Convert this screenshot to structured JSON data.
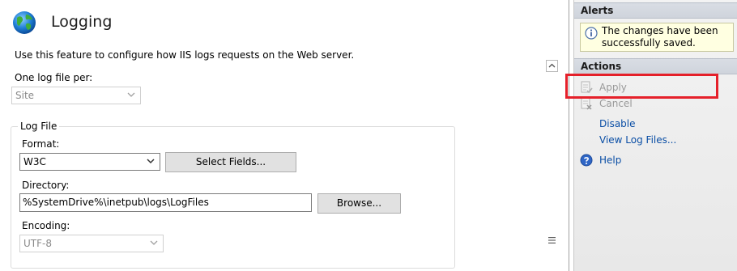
{
  "header": {
    "title": "Logging",
    "icon": "globe-icon"
  },
  "description": "Use this feature to configure how IIS logs requests on the Web server.",
  "log_scope": {
    "label": "One log file per:",
    "value": "Site"
  },
  "log_file": {
    "legend": "Log File",
    "format": {
      "label": "Format:",
      "value": "W3C",
      "select_fields_button": "Select Fields..."
    },
    "directory": {
      "label": "Directory:",
      "value": "%SystemDrive%\\inetpub\\logs\\LogFiles",
      "browse_button": "Browse..."
    },
    "encoding": {
      "label": "Encoding:",
      "value": "UTF-8"
    }
  },
  "alerts": {
    "title": "Alerts",
    "message": "The changes have been successfully saved.",
    "icon": "info-icon"
  },
  "actions": {
    "title": "Actions",
    "apply": "Apply",
    "cancel": "Cancel",
    "disable": "Disable",
    "view_log_files": "View Log Files...",
    "help": "Help"
  },
  "colors": {
    "highlight": "#e5202a",
    "link": "#0a4ea5",
    "alert_bg": "#ffffe1"
  }
}
